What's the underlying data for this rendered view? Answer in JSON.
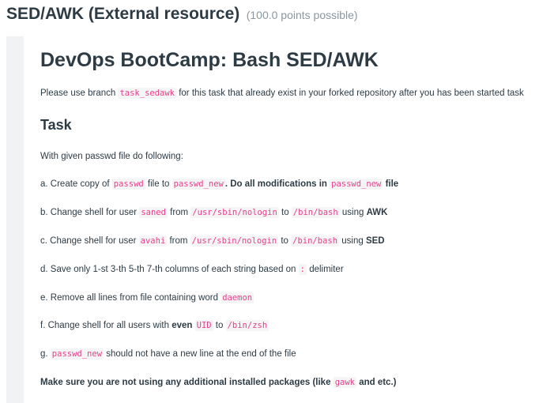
{
  "assignment": {
    "title": "SED/AWK (External resource)",
    "points": "(100.0 points possible)"
  },
  "content": {
    "heading": "DevOps BootCamp: Bash SED/AWK",
    "branch_note": {
      "pre": "Please use branch",
      "code": "task_sedawk",
      "post": "for this task that already exist in your forked repository after you has been started task"
    },
    "task_heading": "Task",
    "intro": "With given passwd file do following:",
    "a": {
      "t1": "a. Create copy of",
      "c1": "passwd",
      "t2": "file to",
      "c2": "passwd_new",
      "b1": "Do all modifications in",
      "c3": "passwd_new",
      "b2": "file"
    },
    "b": {
      "t1": "b. Change shell for user",
      "c1": "saned",
      "t2": "from",
      "c2": "/usr/sbin/nologin",
      "t3": "to",
      "c3": "/bin/bash",
      "t4": "using",
      "b1": "AWK"
    },
    "c": {
      "t1": "c. Change shell for user",
      "c1": "avahi",
      "t2": "from",
      "c2": "/usr/sbin/nologin",
      "t3": "to",
      "c3": "/bin/bash",
      "t4": "using",
      "b1": "SED"
    },
    "d": {
      "t1": "d. Save only 1-st 3-th 5-th 7-th columns of each string based on",
      "c1": ":",
      "t2": "delimiter"
    },
    "e": {
      "t1": "e. Remove all lines from file containing word",
      "c1": "daemon"
    },
    "f": {
      "t1": "f. Change shell for all users with",
      "b1": "even",
      "c1": "UID",
      "t2": "to",
      "c2": "/bin/zsh"
    },
    "g": {
      "t1": "g.",
      "c1": "passwd_new",
      "t2": "should not have a new line at the end of the file"
    },
    "note": {
      "b1": "Make sure you are not using any additional installed packages (like",
      "c1": "gawk",
      "b2": "and etc.)"
    }
  }
}
